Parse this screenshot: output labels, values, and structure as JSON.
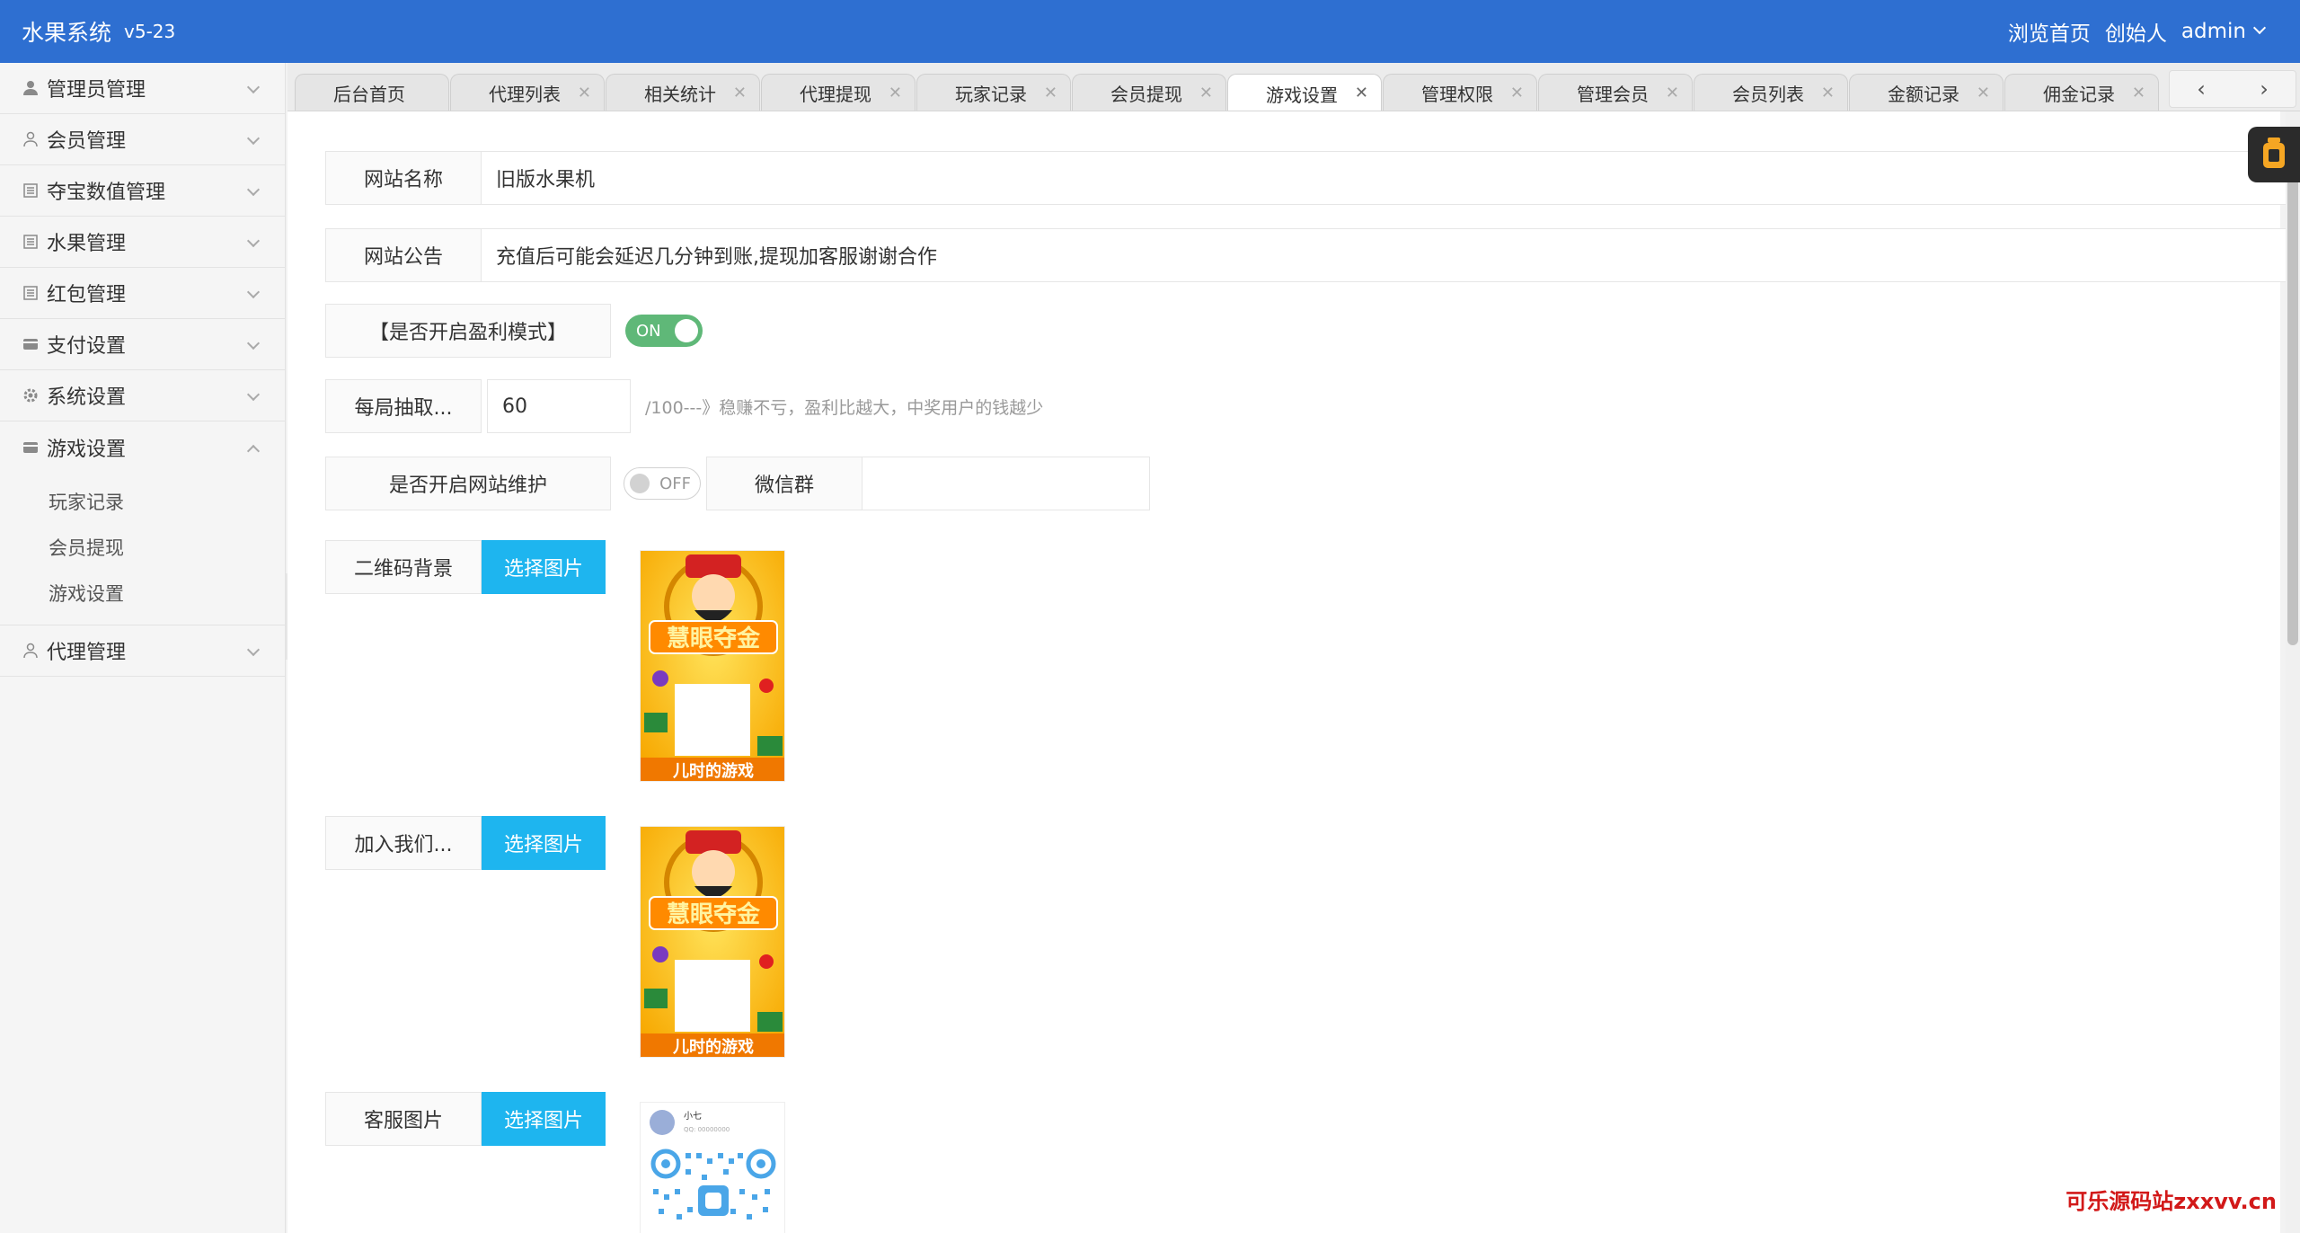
{
  "header": {
    "title": "水果系统",
    "version": "v5-23",
    "links": [
      "浏览首页",
      "创始人",
      "admin"
    ]
  },
  "sidebar": {
    "items": [
      {
        "label": "管理员管理",
        "icon": "user-icon"
      },
      {
        "label": "会员管理",
        "icon": "user-outline-icon"
      },
      {
        "label": "夺宝数值管理",
        "icon": "doc-icon"
      },
      {
        "label": "水果管理",
        "icon": "doc-icon"
      },
      {
        "label": "红包管理",
        "icon": "doc-icon"
      },
      {
        "label": "支付设置",
        "icon": "card-icon"
      },
      {
        "label": "系统设置",
        "icon": "gear-icon"
      },
      {
        "label": "游戏设置",
        "icon": "card-icon"
      }
    ],
    "game_sub": [
      "玩家记录",
      "会员提现",
      "游戏设置"
    ],
    "last_item": {
      "label": "代理管理",
      "icon": "user-outline-icon"
    }
  },
  "tabs": [
    {
      "label": "后台首页",
      "closable": false
    },
    {
      "label": "代理列表",
      "closable": true
    },
    {
      "label": "相关统计",
      "closable": true
    },
    {
      "label": "代理提现",
      "closable": true
    },
    {
      "label": "玩家记录",
      "closable": true
    },
    {
      "label": "会员提现",
      "closable": true
    },
    {
      "label": "游戏设置",
      "closable": true,
      "active": true
    },
    {
      "label": "管理权限",
      "closable": true
    },
    {
      "label": "管理会员",
      "closable": true
    },
    {
      "label": "会员列表",
      "closable": true
    },
    {
      "label": "金额记录",
      "closable": true
    },
    {
      "label": "佣金记录",
      "closable": true
    }
  ],
  "form": {
    "site_name_label": "网站名称",
    "site_name_value": "旧版水果机",
    "notice_label": "网站公告",
    "notice_value": "充值后可能会延迟几分钟到账,提现加客服谢谢合作",
    "profit_mode_label": "【是否开启盈利模式】",
    "profit_mode_state": "ON",
    "per_round_label": "每局抽取...",
    "per_round_value": "60",
    "per_round_hint": "/100---》稳赚不亏，盈利比越大，中奖用户的钱越少",
    "maintenance_label": "是否开启网站维护",
    "maintenance_state": "OFF",
    "wechat_label": "微信群",
    "wechat_value": "",
    "qr_bg_label": "二维码背景",
    "join_label": "加入我们...",
    "service_label": "客服图片",
    "choose_btn": "选择图片",
    "poster_bottom_text": "儿时的游戏",
    "poster_title_text": "慧眼夺金",
    "qr_name": "小七",
    "qr_sub": "QQ: 00000000"
  },
  "watermark": "可乐源码站zxxvv.cn",
  "colors": {
    "header": "#2e6fd1",
    "switch_on": "#5fb878",
    "button": "#1eb5ef"
  }
}
